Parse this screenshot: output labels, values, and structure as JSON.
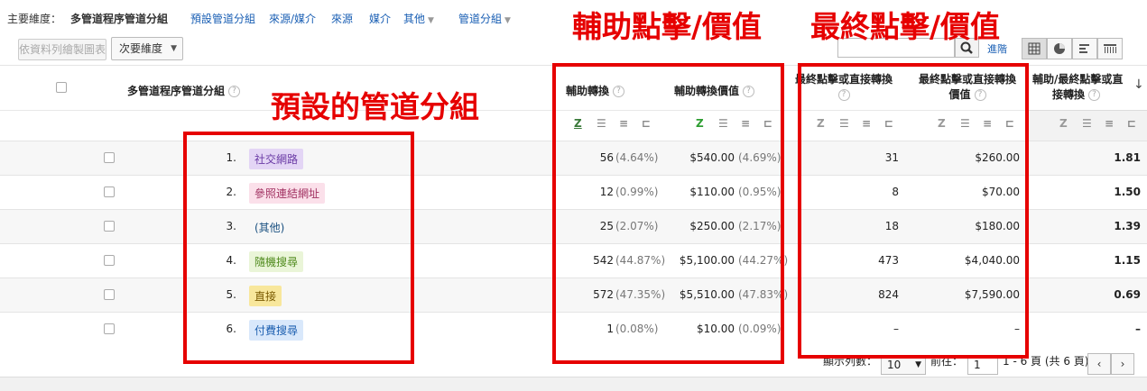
{
  "dimension_bar": {
    "label": "主要維度：",
    "current": "多管道程序管道分組",
    "links": [
      "預設管道分組",
      "來源/媒介",
      "來源",
      "媒介"
    ],
    "other": "其他",
    "channel_group": "管道分組"
  },
  "toolbar": {
    "chart_button": "依資料列繪製圖表",
    "secondary_dim": "次要維度",
    "advanced": "進階"
  },
  "table": {
    "col_dimension": "多管道程序管道分組",
    "col_assist_conv": "輔助轉換",
    "col_assist_value": "輔助轉換價值",
    "col_last_conv": [
      "最終點擊或直接轉換",
      ""
    ],
    "col_last_value": [
      "最終點擊或直接轉換",
      "價值"
    ],
    "col_ratio": [
      "輔助/最終點擊或直",
      "接轉換"
    ],
    "help": "?",
    "rows": [
      {
        "num": "1.",
        "channel": "社交網路",
        "chip_bg": "#e3d5f5",
        "chip_fg": "#6a3aa5",
        "assist": "56",
        "assist_pct": "(4.64%)",
        "assist_val": "$540.00",
        "assist_val_pct": "(4.69%)",
        "last": "31",
        "last_val": "$260.00",
        "ratio": "1.81"
      },
      {
        "num": "2.",
        "channel": "參照連結網址",
        "chip_bg": "#fbe0ea",
        "chip_fg": "#a03060",
        "assist": "12",
        "assist_pct": "(0.99%)",
        "assist_val": "$110.00",
        "assist_val_pct": "(0.95%)",
        "last": "8",
        "last_val": "$70.00",
        "ratio": "1.50"
      },
      {
        "num": "3.",
        "channel": "(其他)",
        "chip_bg": "transparent",
        "chip_fg": "#1a5080",
        "assist": "25",
        "assist_pct": "(2.07%)",
        "assist_val": "$250.00",
        "assist_val_pct": "(2.17%)",
        "last": "18",
        "last_val": "$180.00",
        "ratio": "1.39"
      },
      {
        "num": "4.",
        "channel": "隨機搜尋",
        "chip_bg": "#eaf5d8",
        "chip_fg": "#4f8a1c",
        "assist": "542",
        "assist_pct": "(44.87%)",
        "assist_val": "$5,100.00",
        "assist_val_pct": "(44.27%)",
        "last": "473",
        "last_val": "$4,040.00",
        "ratio": "1.15"
      },
      {
        "num": "5.",
        "channel": "直接",
        "chip_bg": "#f8e79c",
        "chip_fg": "#7a5a00",
        "assist": "572",
        "assist_pct": "(47.35%)",
        "assist_val": "$5,510.00",
        "assist_val_pct": "(47.83%)",
        "last": "824",
        "last_val": "$7,590.00",
        "ratio": "0.69"
      },
      {
        "num": "6.",
        "channel": "付費搜尋",
        "chip_bg": "#d9e8fb",
        "chip_fg": "#1d5fb0",
        "assist": "1",
        "assist_pct": "(0.08%)",
        "assist_val": "$10.00",
        "assist_val_pct": "(0.09%)",
        "last": "–",
        "last_val": "–",
        "ratio": "–"
      }
    ]
  },
  "pagination": {
    "show_rows_label": "顯示列數：",
    "rows_value": "10",
    "goto_label": "前往：",
    "page_value": "1",
    "range_text": "1 - 6 頁 (共 6 頁)"
  },
  "annotations": {
    "assist_title": "輔助點擊/價值",
    "last_title": "最終點擊/價值",
    "default_group": "預設的管道分組"
  },
  "colors": {
    "annotation_red": "#e60000",
    "link_blue": "#1a5fb4"
  }
}
